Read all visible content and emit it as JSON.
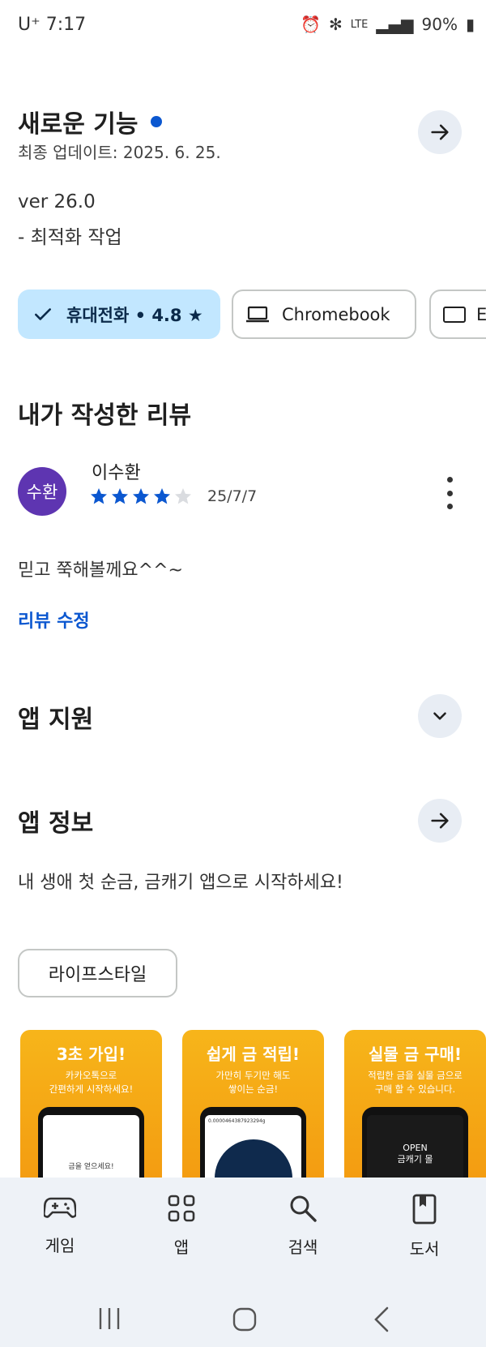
{
  "status_bar": {
    "carrier": "U⁺",
    "time": "7:17",
    "battery": "90%",
    "network": "LTE"
  },
  "whats_new": {
    "title": "새로운 기능",
    "updated": "최종 업데이트: 2025. 6. 25.",
    "version": "ver 26.0",
    "notes": "- 최적화 작업"
  },
  "device_chips": {
    "phone": "휴대전화 • 4.8 ★",
    "chromebook": "Chromebook",
    "third_partial": "E"
  },
  "my_review": {
    "title": "내가 작성한 리뷰",
    "avatar_text": "수환",
    "author": "이수환",
    "rating": 4,
    "stars_total": 5,
    "date": "25/7/7",
    "text": "믿고 쭉해볼께요^^~",
    "edit_label": "리뷰 수정"
  },
  "app_support": {
    "title": "앱 지원"
  },
  "app_info": {
    "title": "앱 정보",
    "description": "내 생애 첫 순금, 금캐기 앱으로 시작하세요!",
    "category_chip": "라이프스타일"
  },
  "screenshots": [
    {
      "headline": "3초 가입!",
      "sub": "카카오톡으로\n간편하게 시작하세요!",
      "screen_text": "금을 얻으세요!"
    },
    {
      "headline": "쉽게 금 적립!",
      "sub": "가만히 두기만 해도\n쌓이는 순금!",
      "screen_text": "0.0000464387923294g"
    },
    {
      "headline": "실물 금 구매!",
      "sub": "적립한 금을 실물 금으로\n구매 할 수 있습니다.",
      "screen_text": "OPEN\n금캐기 몰"
    }
  ],
  "bottom_nav": [
    {
      "label": "게임",
      "icon": "gamepad-icon"
    },
    {
      "label": "앱",
      "icon": "apps-grid-icon"
    },
    {
      "label": "검색",
      "icon": "search-icon"
    },
    {
      "label": "도서",
      "icon": "book-icon"
    }
  ],
  "colors": {
    "accent": "#0b57d0",
    "chip_active": "#c2e7ff",
    "avatar": "#5e35b1",
    "nav_bg": "#eef2f7"
  }
}
